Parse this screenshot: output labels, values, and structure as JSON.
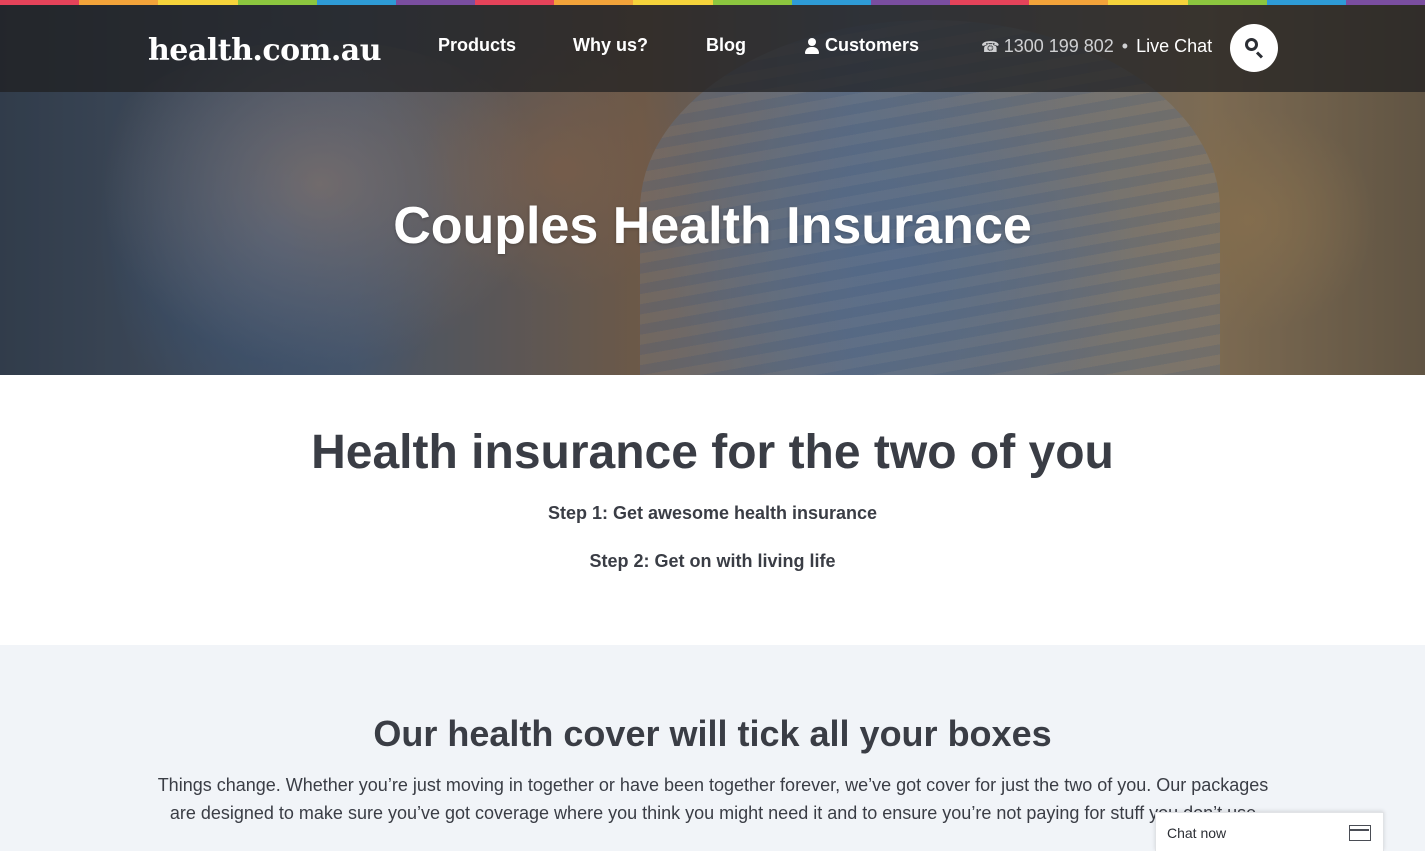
{
  "rainbow_colors": [
    "#e5435a",
    "#f2a33a",
    "#f5d33b",
    "#8cc63f",
    "#2e9bd6",
    "#7a4ea0",
    "#e5435a",
    "#f2a33a",
    "#f5d33b",
    "#8cc63f",
    "#2e9bd6",
    "#7a4ea0",
    "#e5435a",
    "#f2a33a",
    "#f5d33b",
    "#8cc63f",
    "#2e9bd6",
    "#7a4ea0"
  ],
  "header": {
    "logo": "health.com.au",
    "nav": {
      "products": "Products",
      "why_us": "Why us?",
      "blog": "Blog",
      "customers": "Customers"
    },
    "phone": "1300 199 802",
    "separator": "•",
    "live_chat": "Live Chat",
    "icons": {
      "customers": "user-icon",
      "phone": "phone-icon",
      "search": "search-icon"
    }
  },
  "hero": {
    "title": "Couples Health Insurance"
  },
  "intro": {
    "heading": "Health insurance for the two of you",
    "step1": "Step 1: Get awesome health insurance",
    "step2": "Step 2: Get on with living life"
  },
  "boxes": {
    "heading": "Our health cover will tick all your boxes",
    "body": "Things change. Whether you’re just moving in together or have been together forever, we’ve got cover for just the two of you. Our packages are designed to make sure you’ve got coverage where you think you might need it and to ensure you’re not paying for stuff you don’t use"
  },
  "chat_widget": {
    "label": "Chat now",
    "icon": "window-icon"
  }
}
